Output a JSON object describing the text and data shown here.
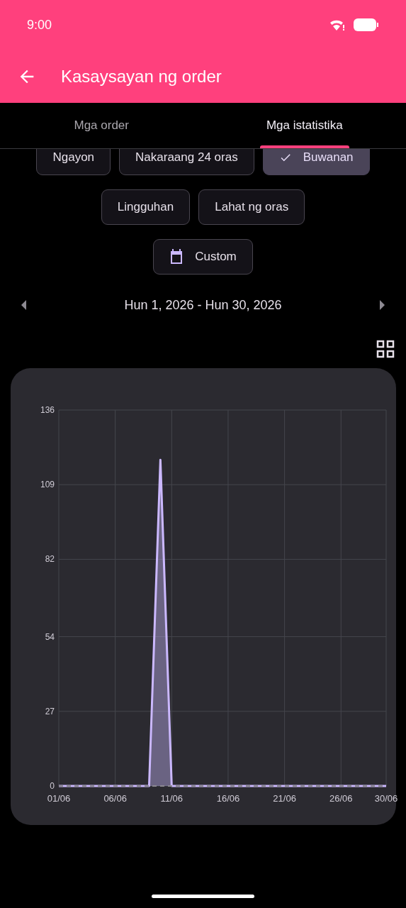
{
  "status_bar": {
    "time": "9:00"
  },
  "app_bar": {
    "title": "Kasaysayan ng order"
  },
  "tabs": [
    {
      "label": "Mga order",
      "selected": false
    },
    {
      "label": "Mga istatistika",
      "selected": true
    }
  ],
  "filter_rows": [
    [
      {
        "kind": "preset",
        "label": "Ngayon",
        "selected": false
      },
      {
        "kind": "preset",
        "label": "Nakaraang 24 oras",
        "selected": false
      },
      {
        "kind": "preset",
        "label": "Buwanan",
        "selected": true
      }
    ],
    [
      {
        "kind": "preset",
        "label": "Lingguhan",
        "selected": false
      },
      {
        "kind": "preset",
        "label": "Lahat ng oras",
        "selected": false
      }
    ],
    [
      {
        "kind": "custom",
        "label": "Custom",
        "selected": false
      }
    ]
  ],
  "date_range": {
    "label": "Hun 1, 2026 - Hun 30, 2026"
  },
  "chart": {
    "chart_data": {
      "type": "area",
      "categories": [
        "01/06",
        null,
        null,
        null,
        null,
        "06/06",
        null,
        null,
        null,
        null,
        "11/06",
        null,
        null,
        null,
        null,
        "16/06",
        null,
        null,
        null,
        null,
        "21/06",
        null,
        null,
        null,
        null,
        "26/06",
        null,
        null,
        null,
        "30/06"
      ],
      "series": [
        {
          "color": "#cbb8ff",
          "values": [
            0,
            0,
            0,
            0,
            0,
            0,
            0,
            0,
            0,
            118,
            0,
            0,
            0,
            0,
            0,
            0,
            0,
            0,
            0,
            0,
            0,
            0,
            0,
            0,
            0,
            0,
            0,
            0,
            0,
            0
          ]
        }
      ],
      "ylim": [
        0,
        136
      ],
      "grid": true,
      "yticks": [
        0,
        27,
        54,
        82,
        109,
        136
      ]
    }
  }
}
